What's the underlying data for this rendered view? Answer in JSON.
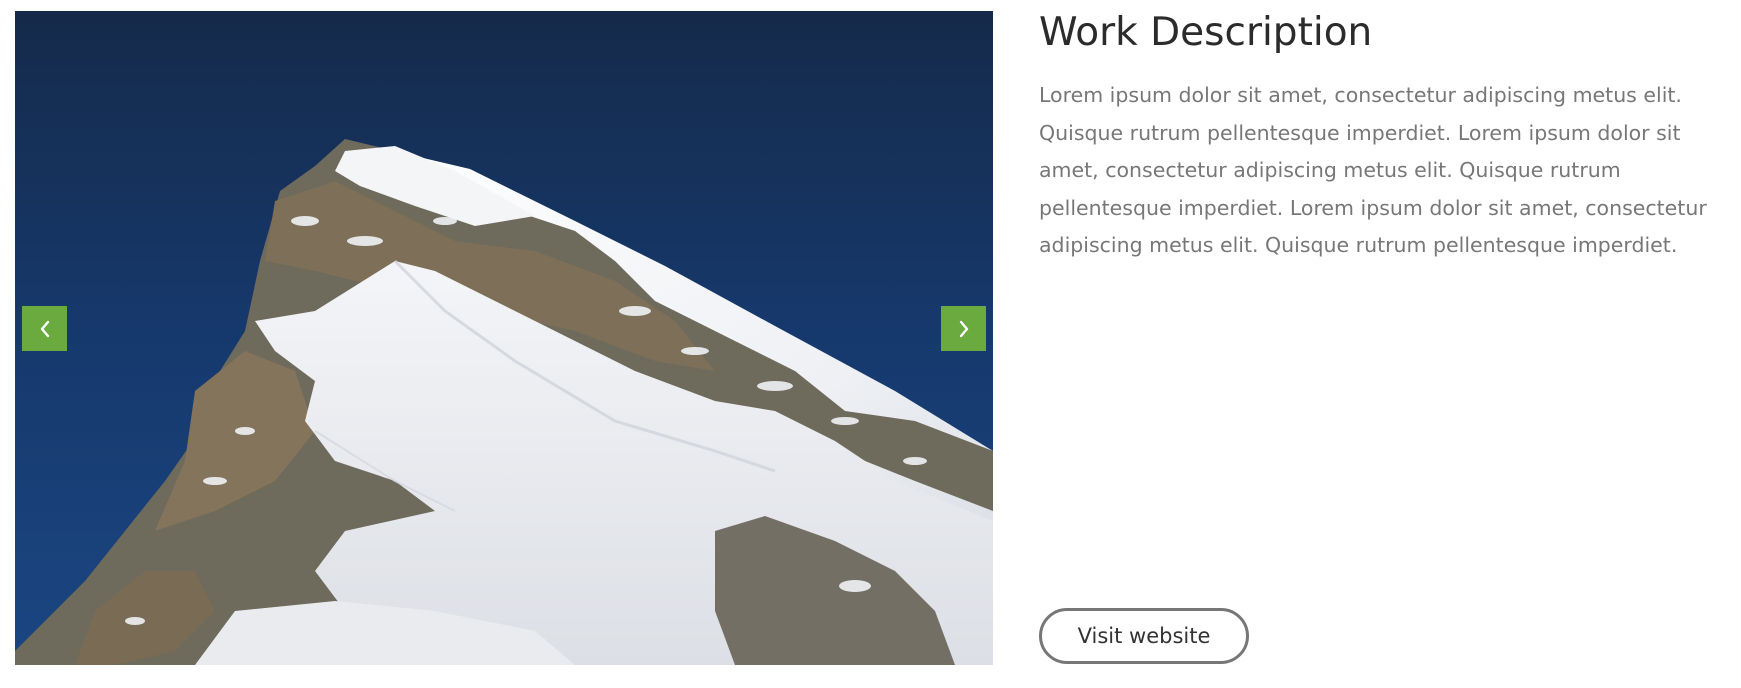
{
  "slider": {
    "image_alt": "Snow-covered mountain peak under a deep blue sky",
    "prev_icon": "chevron-left-icon",
    "next_icon": "chevron-right-icon",
    "accent_color": "#6aaa3f"
  },
  "work": {
    "title": "Work Description",
    "description": "Lorem ipsum dolor sit amet, consectetur adipiscing metus elit. Quisque rutrum pellentesque imperdiet. Lorem ipsum dolor sit amet, consectetur adipiscing metus elit. Quisque rutrum pellentesque imperdiet. Lorem ipsum dolor sit amet, consectetur adipiscing metus elit. Quisque rutrum pellentesque imperdiet.",
    "visit_label": "Visit website"
  }
}
